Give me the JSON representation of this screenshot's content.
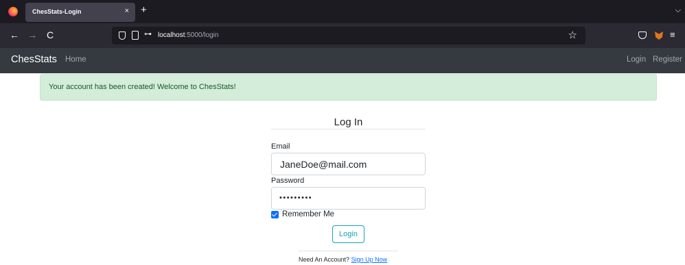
{
  "browser": {
    "tab_title": "ChesStats-Login",
    "tab_close": "×",
    "new_tab": "+",
    "tabs_menu": "⌵",
    "back": "←",
    "forward": "→",
    "reload": "C",
    "url_host": "localhost",
    "url_path": ":5000/login",
    "key_glyph": "⊶",
    "star_glyph": "☆",
    "menu_glyph": "≡"
  },
  "site_nav": {
    "brand": "ChesStats",
    "home": "Home",
    "login": "Login",
    "register": "Register"
  },
  "alert": {
    "message": "Your account has been created! Welcome to ChesStats!",
    "bg_color": "#d4edda",
    "text_color": "#155724"
  },
  "form": {
    "legend": "Log In",
    "email_label": "Email",
    "email_value": "JaneDoe@mail.com",
    "password_label": "Password",
    "password_value": "•••••••••",
    "remember_label": "Remember Me",
    "remember_checked": true,
    "submit_label": "Login",
    "signup_prompt": "Need An Account?",
    "signup_link": "Sign Up Now"
  }
}
